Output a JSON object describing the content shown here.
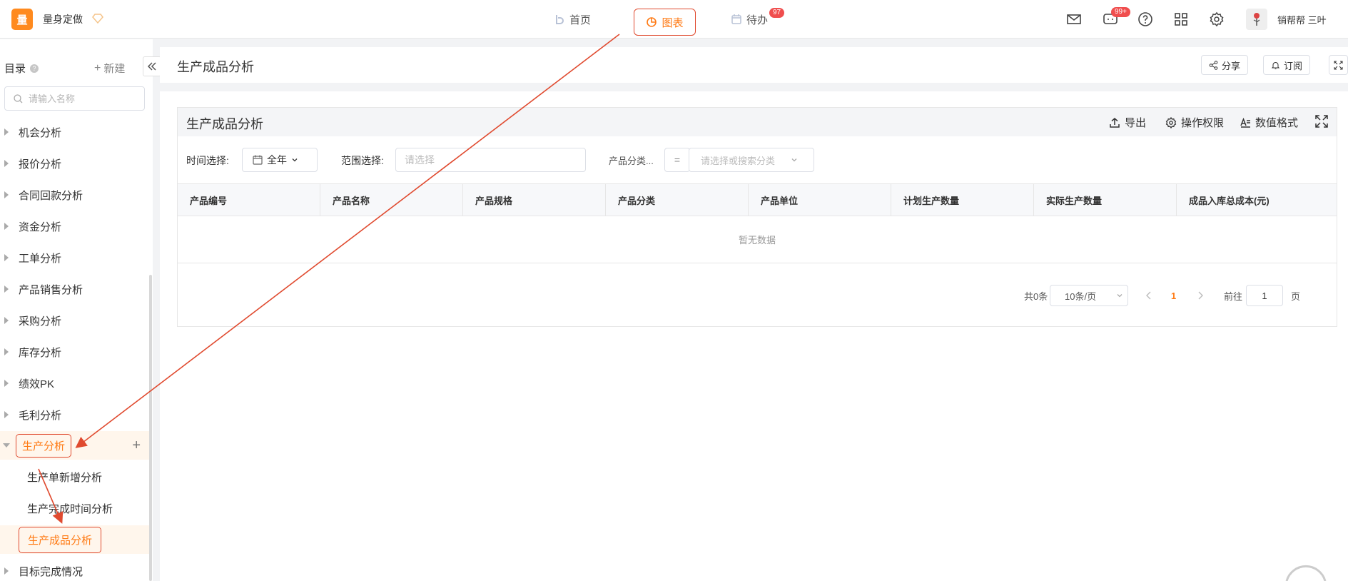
{
  "topbar": {
    "logo_text": "量",
    "app_title": "量身定做",
    "nav": [
      {
        "label": "首页",
        "icon": "home-icon"
      },
      {
        "label": "图表",
        "icon": "chart-icon"
      },
      {
        "label": "待办",
        "icon": "calendar-icon",
        "badge": "97"
      }
    ],
    "message_badge": "99+",
    "user_name": "销帮帮 三叶"
  },
  "sidebar": {
    "title": "目录",
    "new_label": "新建",
    "search_placeholder": "请输入名称",
    "items": [
      "机会分析",
      "报价分析",
      "合同回款分析",
      "资金分析",
      "工单分析",
      "产品销售分析",
      "采购分析",
      "库存分析",
      "绩效PK",
      "毛利分析"
    ],
    "open_item": "生产分析",
    "children": [
      "生产单新增分析",
      "生产完成时间分析",
      "生产成品分析"
    ],
    "after_item": "目标完成情况"
  },
  "page": {
    "title": "生产成品分析",
    "share_label": "分享",
    "subscribe_label": "订阅"
  },
  "card": {
    "title": "生产成品分析",
    "actions": {
      "export": "导出",
      "permission": "操作权限",
      "format": "数值格式"
    },
    "filters": {
      "time_label": "时间选择:",
      "time_value": "全年",
      "range_label": "范围选择:",
      "range_placeholder": "请选择",
      "category_label": "产品分类...",
      "category_op": "=",
      "category_placeholder": "请选择或搜索分类"
    },
    "columns": [
      "产品编号",
      "产品名称",
      "产品规格",
      "产品分类",
      "产品单位",
      "计划生产数量",
      "实际生产数量",
      "成品入库总成本(元)"
    ],
    "empty_text": "暂无数据",
    "pager": {
      "total": "共0条",
      "page_size": "10条/页",
      "current": "1",
      "goto_label": "前往",
      "goto_value": "1",
      "page_unit": "页"
    }
  },
  "colors": {
    "accent": "#ff7a14",
    "annotation": "#e04a2f"
  }
}
